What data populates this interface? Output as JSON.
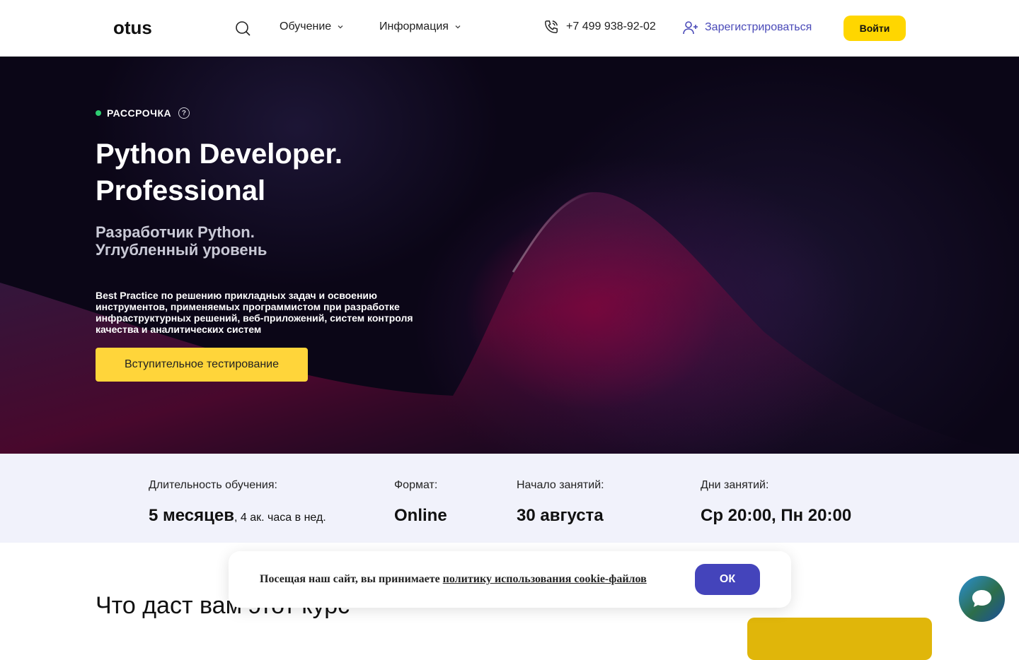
{
  "header": {
    "logo_text": "otus",
    "nav": [
      {
        "label": "Обучение"
      },
      {
        "label": "Информация"
      }
    ],
    "phone": "+7 499 938-92-02",
    "register_label": "Зарегистрироваться",
    "login_label": "Войти"
  },
  "hero": {
    "badge": "РАССРОЧКА",
    "badge_help": "?",
    "title_line1": "Python Developer.",
    "title_line2": "Professional",
    "subtitle_line1": "Разработчик Python.",
    "subtitle_line2": "Углубленный уровень",
    "description": "Best Practice по решению прикладных задач и освоению инструментов, применяемых программистом при разработке инфраструктурных решений, веб-приложений, систем контроля качества и аналитических систем",
    "cta_label": "Вступительное тестирование"
  },
  "info": {
    "duration_label": "Длительность обучения:",
    "duration_value": "5 месяцев",
    "duration_extra": ", 4 ак. часа в нед.",
    "format_label": "Формат:",
    "format_value": "Online",
    "start_label": "Начало занятий:",
    "start_value": "30 августа",
    "days_label": "Дни занятий:",
    "days_value": "Ср 20:00, Пн 20:00"
  },
  "section": {
    "title": "Что даст вам этот курс"
  },
  "cookie": {
    "text": "Посещая наш сайт, вы принимаете ",
    "link": "политику использования cookie-файлов",
    "ok_label": "ОК"
  },
  "colors": {
    "accent_yellow": "#ffd600",
    "accent_blue": "#4444bb",
    "hero_bg": "#0b0617"
  }
}
